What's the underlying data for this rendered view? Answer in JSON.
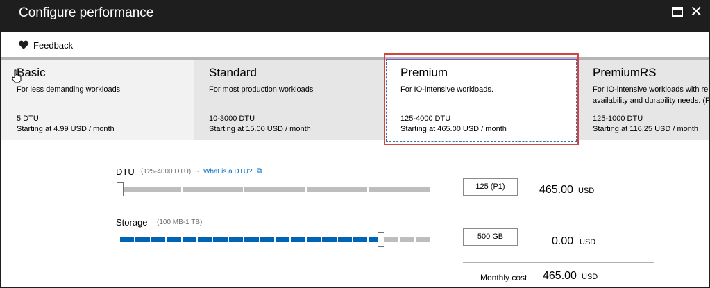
{
  "window": {
    "title": "Configure performance"
  },
  "toolbar": {
    "feedback_label": "Feedback"
  },
  "tiers": [
    {
      "name": "Basic",
      "desc": "For less demanding workloads",
      "dtu": "5 DTU",
      "start": "Starting at 4.99 USD / month"
    },
    {
      "name": "Standard",
      "desc": "For most production workloads",
      "dtu": "10-3000 DTU",
      "start": "Starting at 15.00 USD / month"
    },
    {
      "name": "Premium",
      "desc": "For IO-intensive workloads.",
      "dtu": "125-4000 DTU",
      "start": "Starting at 465.00 USD / month"
    },
    {
      "name": "PremiumRS",
      "desc": "For IO-intensive workloads with re availability and durability needs. (P",
      "dtu": "125-1000 DTU",
      "start": "Starting at 116.25 USD / month"
    }
  ],
  "dtu": {
    "label": "DTU",
    "range": "(125-4000 DTU)",
    "dash": "-",
    "link": "What is a DTU?",
    "value": "125 (P1)",
    "price": "465.00",
    "unit": "USD",
    "level": 0
  },
  "storage": {
    "label": "Storage",
    "range": "(100 MB-1 TB)",
    "value": "500 GB",
    "price": "0.00",
    "unit": "USD",
    "level": 0.85
  },
  "monthly": {
    "label": "Monthly cost",
    "price": "465.00",
    "unit": "USD"
  },
  "colors": {
    "accent": "#0064b4",
    "selection_border": "#d6453d",
    "titlebar": "#1e1e1e"
  }
}
